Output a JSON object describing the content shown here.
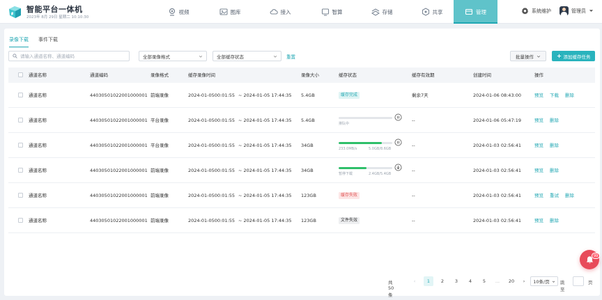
{
  "brand": {
    "title": "智能平台一体机",
    "date": "2023年 8月 29日  星期二  10:10:30"
  },
  "nav": [
    {
      "label": "视频",
      "icon": "camera-icon"
    },
    {
      "label": "图库",
      "icon": "image-icon"
    },
    {
      "label": "接入",
      "icon": "cloud-access-icon"
    },
    {
      "label": "智算",
      "icon": "compute-icon"
    },
    {
      "label": "存储",
      "icon": "storage-icon"
    },
    {
      "label": "共享",
      "icon": "share-icon"
    },
    {
      "label": "管理",
      "icon": "manage-icon"
    }
  ],
  "header": {
    "system": "系统维护",
    "user": "管理员"
  },
  "tabs": [
    "录像下载",
    "事件下载"
  ],
  "toolbar": {
    "search_placeholder": "请输入通道名称、通道编码",
    "format_select": "全部录像格式",
    "status_select": "全部缓存状态",
    "reset": "重置",
    "batch": "批量操作",
    "add": "添加缓存任务"
  },
  "columns": [
    "通道名称",
    "通道编码",
    "录像格式",
    "缓存录像时间",
    "录像大小",
    "缓存状态",
    "缓存有效期",
    "创建时间",
    "操作"
  ],
  "rows": [
    {
      "name": "通道名称",
      "code": "44030501022001000001",
      "format": "前端录像",
      "start": "2024-01-0500:01:55",
      "end": "~ 2024-01-05 17:44:35",
      "size": "5.4GB",
      "status": "缓存完成",
      "expiry": "剩余7天",
      "created": "2024-01-06 08:43:00",
      "actions": [
        "预览",
        "下载",
        "删除"
      ]
    },
    {
      "name": "通道名称",
      "code": "44030501022001000001",
      "format": "平台录像",
      "start": "2024-01-0500:01:55",
      "end": "~ 2024-01-05 17:44:35",
      "size": "5.4GB",
      "progress": {
        "value": 0,
        "t1": "排队中",
        "t2": ""
      },
      "expiry": "--",
      "created": "2024-01-06 05:47:19",
      "actions": [
        "预览",
        "删除"
      ]
    },
    {
      "name": "通道名称",
      "code": "44030501022001000001",
      "format": "平台录像",
      "start": "2024-01-0500:01:55",
      "end": "~ 2024-01-05 17:44:35",
      "size": "34GB",
      "progress": {
        "value": 0.8,
        "t1": "233.0MB/s",
        "t2": "5.0GB/8.6GB"
      },
      "expiry": "--",
      "created": "2024-01-03 02:56:41",
      "actions": [
        "预览",
        "删除"
      ]
    },
    {
      "name": "通道名称",
      "code": "44030501022001000001",
      "format": "前端录像",
      "start": "2024-01-0500:01:55",
      "end": "~ 2024-01-05 17:44:35",
      "size": "34GB",
      "progress": {
        "value": 0.52,
        "t1": "暂停下载",
        "t2": "2.4GB/5.4GB"
      },
      "expiry": "--",
      "created": "2024-01-03 02:56:41",
      "actions": [
        "预览",
        "删除"
      ]
    },
    {
      "name": "通道名称",
      "code": "44030501022001000001",
      "format": "前端录像",
      "start": "2024-01-0500:01:55",
      "end": "~ 2024-01-05 17:44:35",
      "size": "123GB",
      "status": "缓存失败",
      "expiry": "--",
      "created": "2024-01-03 02:56:41",
      "actions": [
        "预览",
        "重试",
        "删除"
      ]
    },
    {
      "name": "通道名称",
      "code": "44030501022001000001",
      "format": "前端录像",
      "start": "2024-01-0500:01:55",
      "end": "~ 2024-01-05 17:44:35",
      "size": "123GB",
      "status": "文件失效",
      "expiry": "--",
      "created": "2024-01-03 02:56:41",
      "actions": [
        "预览",
        "删除"
      ]
    }
  ],
  "pagination": {
    "total": "共50条",
    "pages": [
      "1",
      "2",
      "3",
      "4",
      "5",
      "...",
      "20"
    ],
    "size": "10条/页",
    "jump": "跳至",
    "unit": "页"
  },
  "notification": {
    "count": "99"
  },
  "colors": {
    "accent": "#21a7b3",
    "nav_active": "#5fc3ca",
    "success_bar": "#2fbf6a",
    "danger": "#e05656",
    "notif": "#e84b5a"
  }
}
